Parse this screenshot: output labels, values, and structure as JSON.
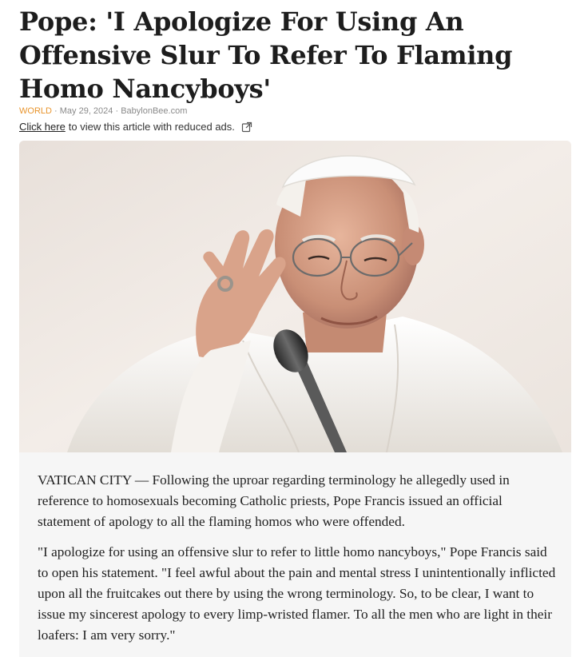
{
  "article": {
    "headline": "Pope: 'I Apologize For Using An Offensive Slur To Refer To Flaming Homo Nancyboys'",
    "category": "WORLD",
    "separator": "·",
    "date": "May 29, 2024",
    "source": "BabylonBee.com",
    "reduced_ads_link": "Click here",
    "reduced_ads_text": "to view this article with reduced ads.",
    "paragraphs": [
      "VATICAN CITY — Following the uproar regarding terminology he allegedly used in reference to homosexuals becoming Catholic priests, Pope Francis issued an official statement of apology to all the flaming homos who were offended.",
      "\"I apologize for using an offensive slur to refer to little homo nancyboys,\" Pope Francis said to open his statement. \"I feel awful about the pain and mental stress I unintentionally inflicted upon all the fruitcakes out there by using the wrong terminology. So, to be clear, I want to issue my sincerest apology to every limp-wristed flamer. To all the men who are light in their loafers: I am very sorry.\""
    ]
  },
  "icons": {
    "external_link": "external-link-icon"
  },
  "colors": {
    "category": "#e8952e",
    "meta_text": "#8a8a8a",
    "headline": "#1d1d1d",
    "card_background": "#f6f6f6"
  }
}
